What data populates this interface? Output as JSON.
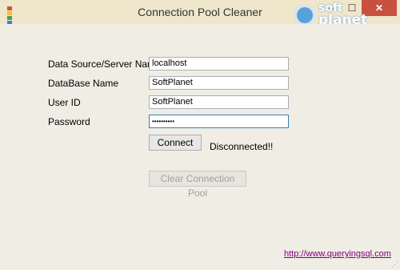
{
  "window": {
    "title": "Connection Pool Cleaner",
    "minimize_glyph": "–",
    "maximize_glyph": "☐",
    "close_glyph": "✕",
    "icon_colors": [
      "#d94b3b",
      "#f2c230",
      "#4aa34a",
      "#3b7bd9"
    ]
  },
  "watermark": {
    "line1": "soft",
    "line2": "planet"
  },
  "form": {
    "server_label": "Data Source/Server Name",
    "server_value": "localhost",
    "database_label": "DataBase Name",
    "database_value": "SoftPlanet",
    "userid_label": "User ID",
    "userid_value": "SoftPlanet",
    "password_label": "Password",
    "password_value": "••••••••••"
  },
  "actions": {
    "connect_label": "Connect",
    "status_text": "Disconnected!!",
    "clear_label": "Clear Connection Pool"
  },
  "footer": {
    "link_text": "http://www.queryingsql.com"
  },
  "colors": {
    "close_button": "#c7503f",
    "link": "#800080",
    "window_bg": "#f0ede4"
  }
}
